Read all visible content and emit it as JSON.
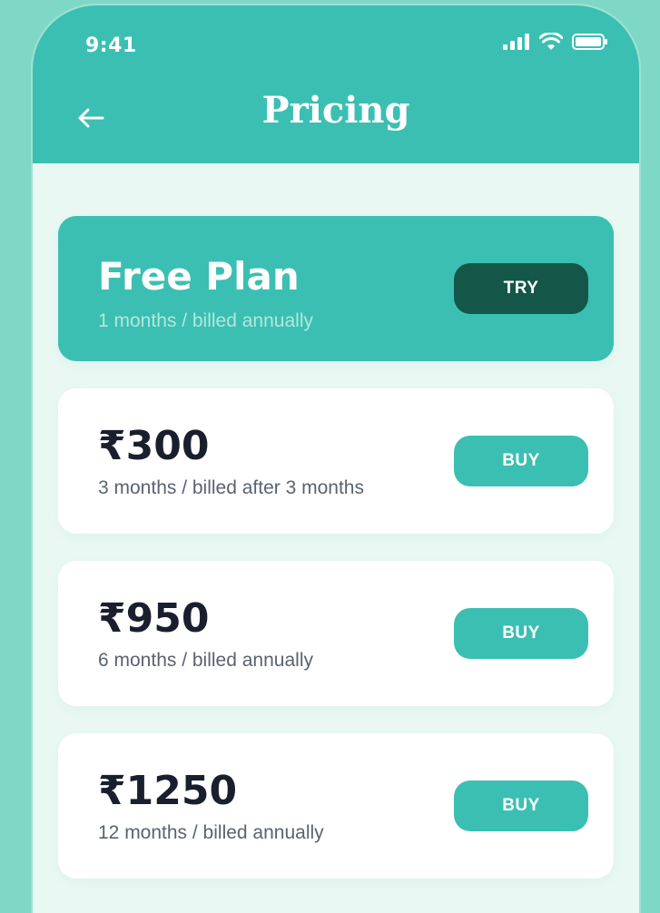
{
  "status_bar": {
    "time": "9:41"
  },
  "header": {
    "title": "Pricing",
    "back_icon": "arrow-left-icon"
  },
  "plans": [
    {
      "title": "Free Plan",
      "subtitle": "1 months / billed annually",
      "button_label": "TRY"
    },
    {
      "title": "₹300",
      "subtitle": "3 months / billed after 3 months",
      "button_label": "BUY"
    },
    {
      "title": "₹950",
      "subtitle": "6 months / billed annually",
      "button_label": "BUY"
    },
    {
      "title": "₹1250",
      "subtitle": "12 months / billed annually",
      "button_label": "BUY"
    }
  ],
  "colors": {
    "accent": "#3bbfb2",
    "dark_button": "#145748",
    "background": "#e9f8f3",
    "outer": "#7fd8c6"
  }
}
